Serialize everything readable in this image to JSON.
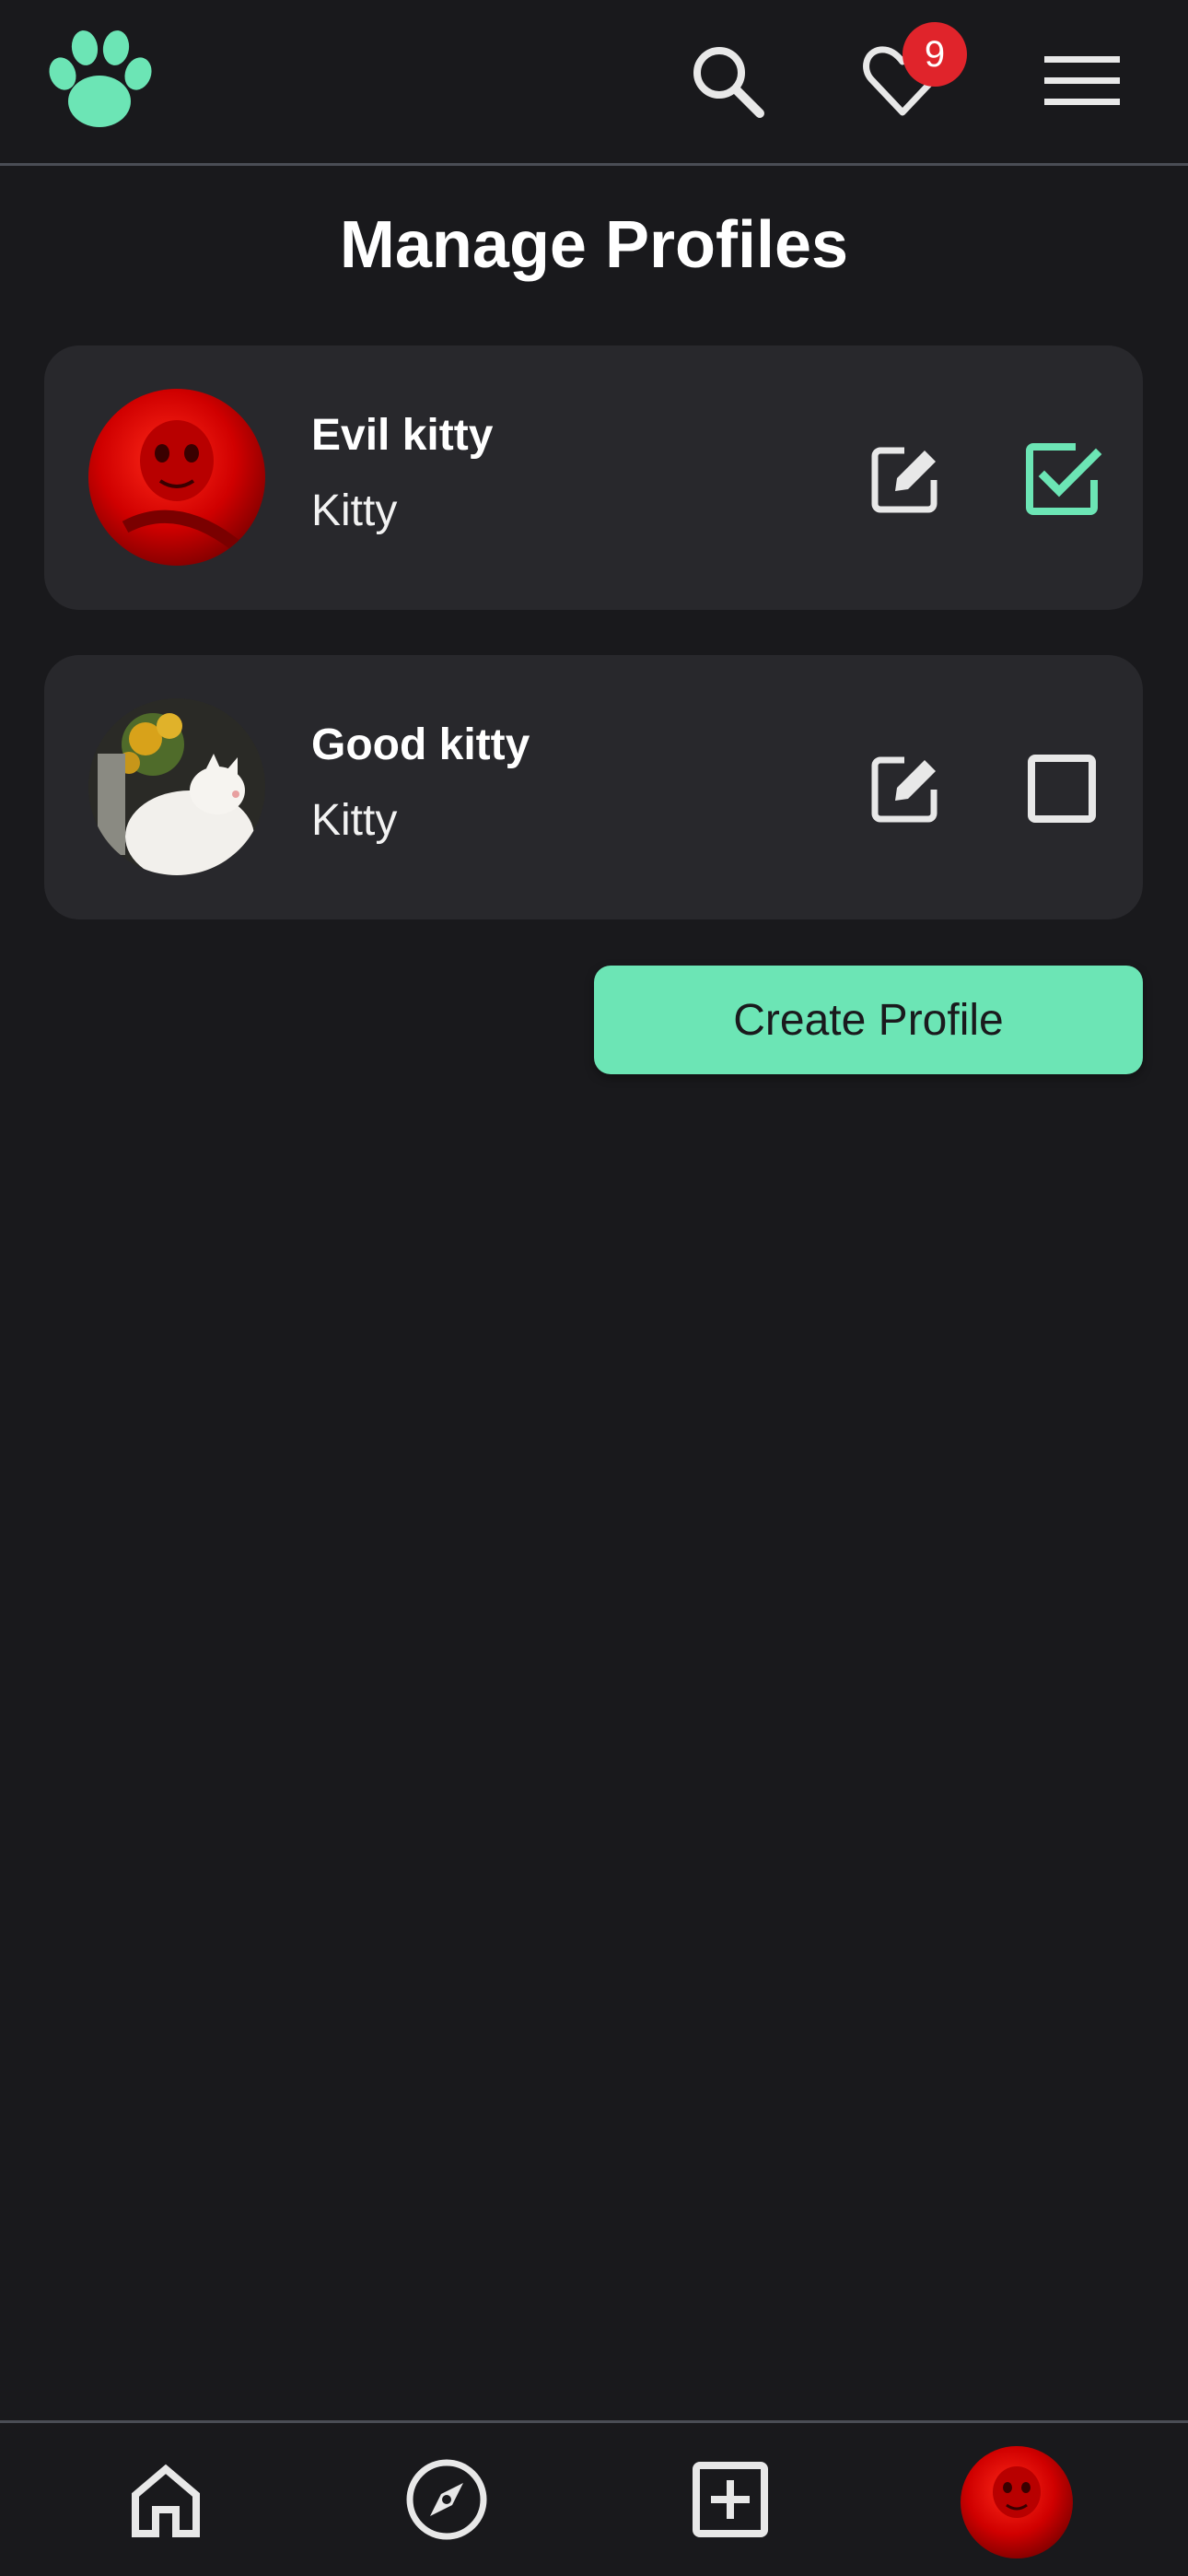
{
  "header": {
    "logo": "paw-icon",
    "search": "search-icon",
    "likes": "heart-icon",
    "likes_badge": "9",
    "menu": "menu-icon"
  },
  "page": {
    "title": "Manage Profiles"
  },
  "profiles": [
    {
      "name": "Evil kitty",
      "type": "Kitty",
      "avatar": "red cat photo",
      "selected": true
    },
    {
      "name": "Good kitty",
      "type": "Kitty",
      "avatar": "white cat with sunflowers photo",
      "selected": false
    }
  ],
  "actions": {
    "create_label": "Create Profile"
  },
  "nav": {
    "items": [
      "home-icon",
      "compass-icon",
      "plus-square-icon",
      "profile-avatar"
    ]
  },
  "colors": {
    "accent": "#6ce5b5",
    "background": "#19191c",
    "card": "#28282c",
    "badge": "#e0242b"
  }
}
